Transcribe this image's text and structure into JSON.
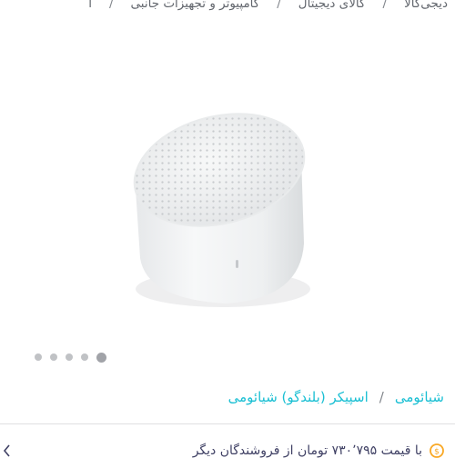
{
  "breadcrumb": {
    "items": [
      "دیجی‌کالا",
      "کالای دیجیتال",
      "کامپیوتر و تجهیزات جانبی",
      "ا"
    ],
    "separator": "/"
  },
  "gallery": {
    "image_icon": "speaker-product-image",
    "slide_count": 5,
    "active_slide": 5
  },
  "brand_line": {
    "brand": "شیائومی",
    "separator": "/",
    "category": "اسپیکر (بلندگو) شیائومی"
  },
  "seller_offer": {
    "text": "با قیمت ۷۳۰٬۷۹۵ تومان از فروشندگان دیگر"
  },
  "colors": {
    "accent": "#19bfd3",
    "text": "#3f4064",
    "muted": "#62666d",
    "coin": "#f9a825"
  }
}
